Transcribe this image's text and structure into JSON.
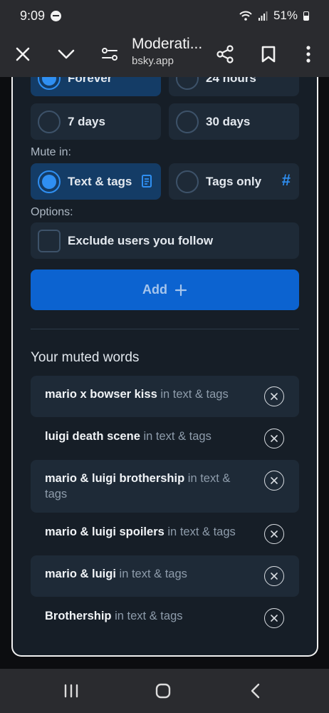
{
  "status_bar": {
    "time": "9:09",
    "battery": "51%"
  },
  "browser": {
    "title": "Moderati...",
    "url": "bsky.app"
  },
  "duration": {
    "options": [
      {
        "label": "Forever",
        "selected": true
      },
      {
        "label": "24 hours",
        "selected": false
      },
      {
        "label": "7 days",
        "selected": false
      },
      {
        "label": "30 days",
        "selected": false
      }
    ]
  },
  "mute_in": {
    "label": "Mute in:",
    "options": [
      {
        "label": "Text & tags",
        "selected": true,
        "icon": "document-icon"
      },
      {
        "label": "Tags only",
        "selected": false,
        "icon": "hashtag-icon",
        "icon_glyph": "#"
      }
    ]
  },
  "options": {
    "label": "Options:",
    "exclude_following": {
      "label": "Exclude users you follow",
      "checked": false
    }
  },
  "add_button": {
    "label": "Add"
  },
  "muted_words": {
    "title": "Your muted words",
    "items": [
      {
        "word": "mario x bowser kiss",
        "scope": "in text & tags"
      },
      {
        "word": "luigi death scene",
        "scope": "in text & tags"
      },
      {
        "word": "mario & luigi brothership",
        "scope": "in text & tags"
      },
      {
        "word": "mario & luigi spoilers",
        "scope": "in text & tags"
      },
      {
        "word": "mario & luigi",
        "scope": "in text & tags"
      },
      {
        "word": "Brothership",
        "scope": "in text & tags"
      }
    ]
  },
  "colors": {
    "accent": "#2f8ff2",
    "button": "#0c63d0",
    "panel_bg": "#161e27",
    "row_bg": "#1e2a37",
    "selected_bg": "#143c66"
  }
}
